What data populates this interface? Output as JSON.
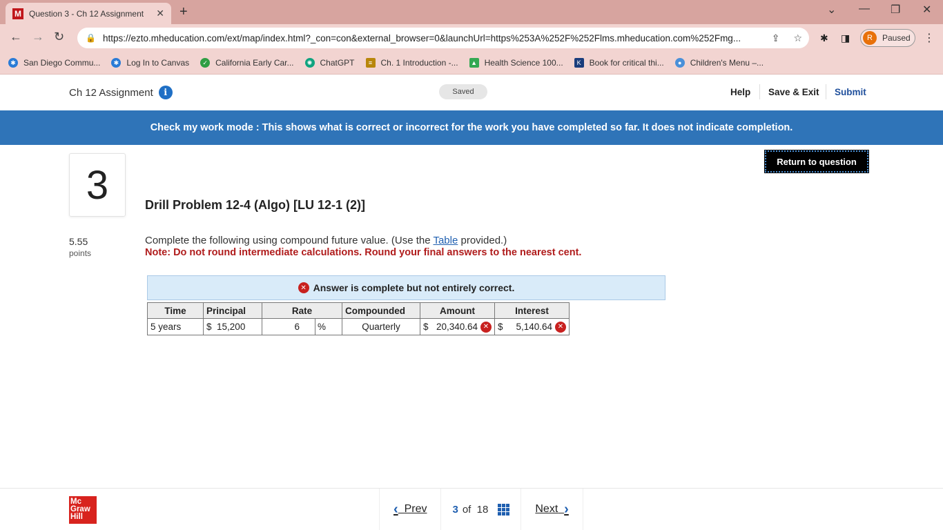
{
  "browser": {
    "tab_title": "Question 3 - Ch 12 Assignment",
    "favicon_letter": "M",
    "url": "https://ezto.mheducation.com/ext/map/index.html?_con=con&external_browser=0&launchUrl=https%253A%252F%252Flms.mheducation.com%252Fmg...",
    "profile_initial": "R",
    "profile_status": "Paused",
    "bookmarks": [
      {
        "label": "San Diego Commu...",
        "color": "#2a7bd6"
      },
      {
        "label": "Log In to Canvas",
        "color": "#2a7bd6"
      },
      {
        "label": "California Early Car...",
        "color": "#2f9e44"
      },
      {
        "label": "ChatGPT",
        "color": "#10a37f"
      },
      {
        "label": "Ch. 1 Introduction -...",
        "color": "#b8860b"
      },
      {
        "label": "Health Science 100...",
        "color": "#34a853"
      },
      {
        "label": "Book for critical thi...",
        "color": "#1a3d7c"
      },
      {
        "label": "Children's Menu –...",
        "color": "#4a90d9"
      }
    ]
  },
  "header": {
    "assignment_title": "Ch 12 Assignment",
    "saved": "Saved",
    "help": "Help",
    "save_exit": "Save & Exit",
    "submit": "Submit"
  },
  "banner": "Check my work mode : This shows what is correct or incorrect for the work you have completed so far. It does not indicate completion.",
  "return_button": "Return to question",
  "question": {
    "number": "3",
    "title": "Drill Problem 12-4 (Algo) [LU 12-1 (2)]",
    "points_value": "5.55",
    "points_label": "points",
    "instruction_pre": "Complete the following using compound future value. (Use the ",
    "instruction_link": "Table",
    "instruction_post": " provided.)",
    "note": "Note: Do not round intermediate calculations. Round your final answers to the nearest cent.",
    "answer_status": "Answer is complete but not entirely correct."
  },
  "table": {
    "headers": [
      "Time",
      "Principal",
      "Rate",
      "Compounded",
      "Amount",
      "Interest"
    ],
    "row": {
      "time": "5 years",
      "principal_currency": "$",
      "principal": "15,200",
      "rate": "6",
      "rate_unit": "%",
      "compounded": "Quarterly",
      "amount_currency": "$",
      "amount": "20,340.64",
      "interest_currency": "$",
      "interest": "5,140.64"
    }
  },
  "footer": {
    "logo_line1": "Mc",
    "logo_line2": "Graw",
    "logo_line3": "Hill",
    "prev": "Prev",
    "next": "Next",
    "current_page": "3",
    "of_label": "of",
    "total_pages": "18"
  }
}
